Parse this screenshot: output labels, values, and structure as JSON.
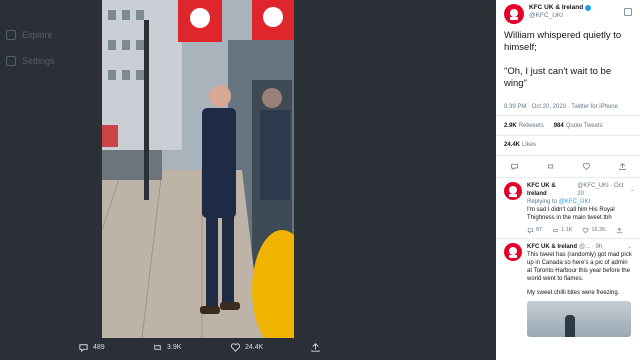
{
  "background_menu": [
    {
      "label": "Explore"
    },
    {
      "label": "Settings"
    }
  ],
  "photo_actions": {
    "replies": "489",
    "retweets": "3.9K",
    "likes": "24.4K"
  },
  "tweet": {
    "author_name": "KFC UK & Ireland",
    "author_handle": "@KFC_UKI",
    "text_line1": "William whispered quietly to himself;",
    "text_line2": "\"Oh, I just can't wait to be wing\"",
    "timestamp": "8:39 PM · Oct 20, 2020 · Twitter for iPhone",
    "retweets_count": "2.9K",
    "retweets_label": "Retweets",
    "quote_count": "984",
    "quote_label": "Quote Tweets",
    "likes_count": "24.4K",
    "likes_label": "Likes"
  },
  "replies": [
    {
      "name": "KFC UK & Ireland",
      "handle": "@KFC_UKI · Oct 20",
      "replying_prefix": "Replying to",
      "replying_to": "@KFC_UKI",
      "text": "I'm sad I didn't call him His Royal Thighness in the main tweet tbh",
      "reply_count": "87",
      "retweet_count": "1.1K",
      "like_count": "16.2K"
    },
    {
      "name": "KFC UK & Ireland",
      "handle": "@... · 9h",
      "text": "This tweet has (randomly) got mad pick up in Canada so here's a pic of admin at Toronto Harbour this year before the world went to flames.",
      "text2": "My sweet chilli bites were freezing."
    }
  ],
  "colors": {
    "brand_red": "#e4002b",
    "twitter_blue": "#1da1f2",
    "overlay": "#2b2f36"
  }
}
